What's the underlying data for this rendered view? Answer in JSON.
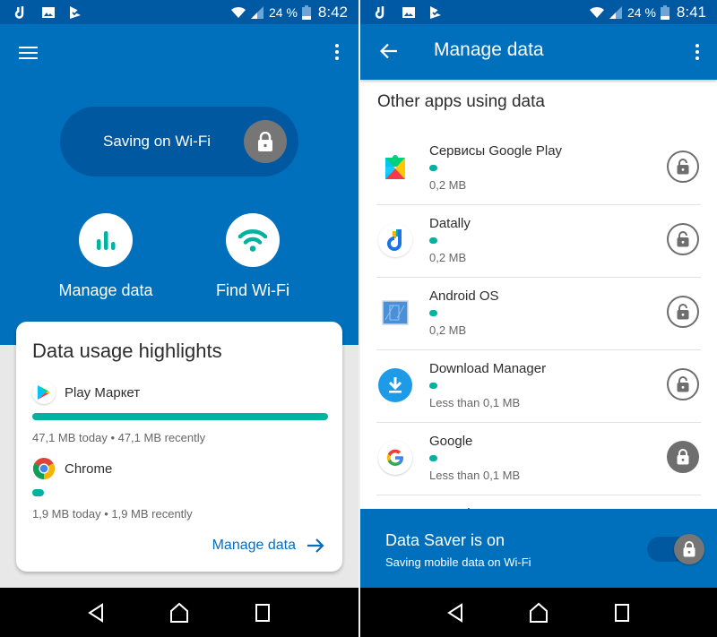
{
  "left": {
    "status_bar": {
      "battery_pct": "24 %",
      "time": "8:42",
      "notification_icons": [
        "datally-icon",
        "image-icon",
        "check-flag-icon"
      ]
    },
    "saving_pill": {
      "label": "Saving on Wi-Fi",
      "icon": "lock-icon"
    },
    "actions": [
      {
        "label": "Manage data",
        "icon": "bar-chart-icon"
      },
      {
        "label": "Find Wi-Fi",
        "icon": "wifi-icon"
      }
    ],
    "card": {
      "title": "Data usage highlights",
      "items": [
        {
          "name": "Play Маркет",
          "icon": "play-store-icon",
          "usage_text": "47,1 MB today  •  47,1 MB recently",
          "bar_fraction": 1.0
        },
        {
          "name": "Chrome",
          "icon": "chrome-icon",
          "usage_text": "1,9 MB today  •  1,9 MB recently",
          "bar_fraction": 0.04
        }
      ],
      "link_label": "Manage data"
    }
  },
  "right": {
    "status_bar": {
      "battery_pct": "24 %",
      "time": "8:41"
    },
    "app_bar": {
      "title": "Manage data"
    },
    "section_title": "Other apps using data",
    "apps": [
      {
        "name": "Сервисы Google Play",
        "usage": "0,2 MB",
        "icon": "google-play-services-icon",
        "locked": false
      },
      {
        "name": "Datally",
        "usage": "0,2 MB",
        "icon": "datally-icon",
        "locked": false
      },
      {
        "name": "Android OS",
        "usage": "0,2 MB",
        "icon": "android-os-icon",
        "locked": false
      },
      {
        "name": "Download Manager",
        "usage": "Less than 0,1 MB",
        "icon": "download-manager-icon",
        "locked": false
      },
      {
        "name": "Google",
        "usage": "Less than 0,1 MB",
        "icon": "google-icon",
        "locked": true
      },
      {
        "name": "YouTube",
        "usage": "",
        "icon": "",
        "locked": false
      }
    ],
    "saver_banner": {
      "title": "Data Saver is on",
      "subtitle": "Saving mobile data on Wi-Fi",
      "toggle_on": true
    }
  },
  "colors": {
    "primary": "#0070bc",
    "primary_dark": "#0059a3",
    "accent_teal": "#00b3a0",
    "link_blue": "#0a6cbc",
    "lock_gray": "#767676"
  }
}
